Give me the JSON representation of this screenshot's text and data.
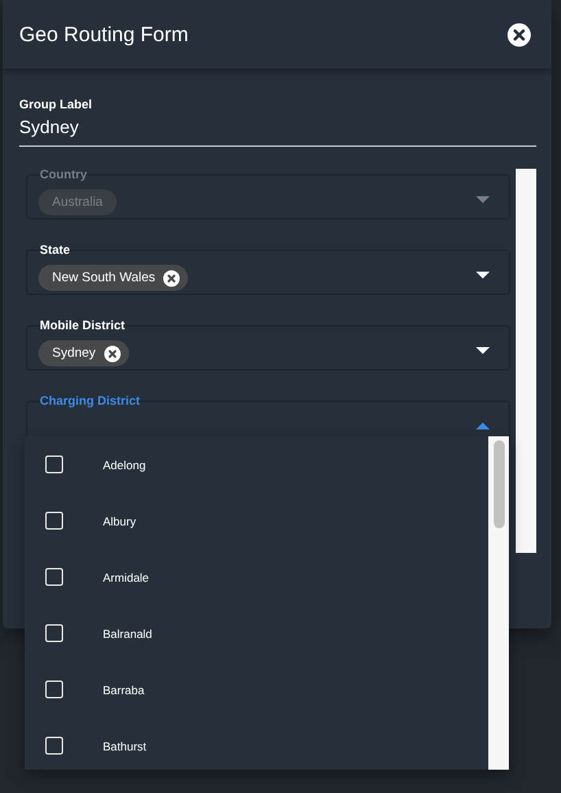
{
  "dialog": {
    "title": "Geo Routing Form"
  },
  "group_label": {
    "label": "Group Label",
    "value": "Sydney"
  },
  "fields": [
    {
      "label": "Country",
      "disabled": true,
      "focused": false,
      "expanded": false,
      "chips": [
        {
          "text": "Australia",
          "removable": false
        }
      ]
    },
    {
      "label": "State",
      "disabled": false,
      "focused": false,
      "expanded": false,
      "chips": [
        {
          "text": "New South Wales",
          "removable": true
        }
      ]
    },
    {
      "label": "Mobile District",
      "disabled": false,
      "focused": false,
      "expanded": false,
      "chips": [
        {
          "text": "Sydney",
          "removable": true
        }
      ]
    },
    {
      "label": "Charging District",
      "disabled": false,
      "focused": true,
      "expanded": true
    }
  ],
  "options": [
    {
      "label": "Adelong",
      "checked": false
    },
    {
      "label": "Albury",
      "checked": false
    },
    {
      "label": "Armidale",
      "checked": false
    },
    {
      "label": "Balranald",
      "checked": false
    },
    {
      "label": "Barraba",
      "checked": false
    },
    {
      "label": "Bathurst",
      "checked": false
    }
  ]
}
